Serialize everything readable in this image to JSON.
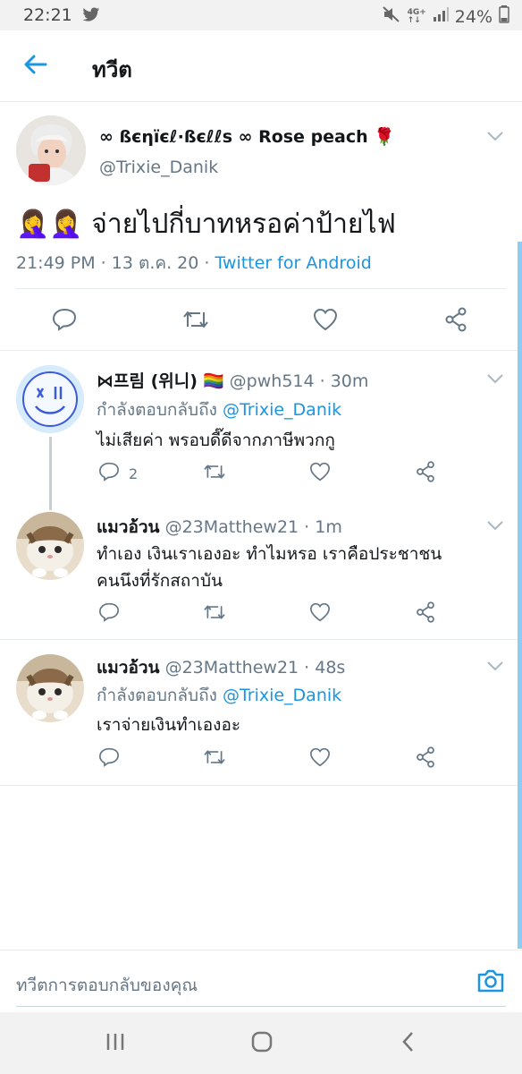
{
  "status_bar": {
    "time": "22:21",
    "network_top": "4G+",
    "network_bottom": "↑↓",
    "battery": "24%"
  },
  "header": {
    "title": "ทวีต"
  },
  "main_tweet": {
    "display_name": "∞ ßєηїєℓ·ßєℓℓѕ ∞ Rose peach",
    "name_emoji": "🌹",
    "handle": "@Trixie_Danik",
    "emoji": "🤦‍♀️🤦‍♀️",
    "text": "จ่ายไปกี่บาทหรอค่าป้ายไฟ",
    "time": "21:49 PM · 13 ต.ค. 20 · ",
    "source": "Twitter for Android"
  },
  "replies": [
    {
      "name": "⋈프림 (위니)",
      "flag": "🏳️‍🌈",
      "handle": "@pwh514 · 30m",
      "reply_prefix": "กำลังตอบกลับถึง ",
      "reply_to": "@Trixie_Danik",
      "text_lines": [
        "ไม่เสียค่า พรอบดี๊ดีจากภาษีพวกกู"
      ],
      "reply_count": "2"
    },
    {
      "name": "แมวอ้วน",
      "handle": "@23Matthew21 · 1m",
      "text_lines": [
        "ทำเอง เงินเราเองอะ ทำไมหรอ เราคือประชาชน",
        "คนนึงที่รักสถาบัน"
      ]
    },
    {
      "name": "แมวอ้วน",
      "handle": "@23Matthew21 · 48s",
      "reply_prefix": "กำลังตอบกลับถึง ",
      "reply_to": "@Trixie_Danik",
      "text_lines": [
        "เราจ่ายเงินทำเองอะ"
      ]
    }
  ],
  "compose": {
    "placeholder": "ทวีตการตอบกลับของคุณ"
  },
  "icons": {
    "back": "arrow-left-icon",
    "caret": "chevron-down-icon",
    "reply": "comment-bubble-icon",
    "retweet": "retweet-icon",
    "like": "heart-icon",
    "share": "share-icon",
    "camera": "camera-icon"
  },
  "colors": {
    "accent": "#1b95e0",
    "secondary_text": "#657786",
    "divider": "#e6ecf0"
  }
}
